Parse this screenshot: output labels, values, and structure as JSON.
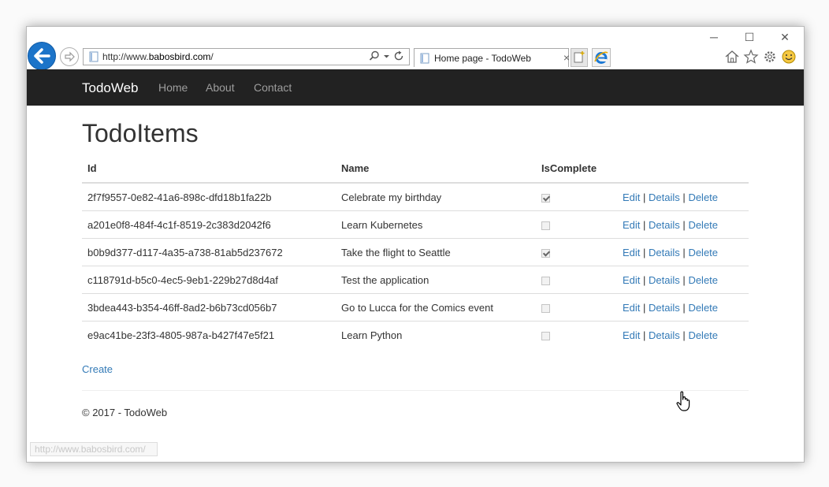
{
  "browser": {
    "url_prefix": "http://www.",
    "url_host": "babosbird.com",
    "url_suffix": "/",
    "tab_title": "Home page - TodoWeb",
    "tab_close": "×",
    "status_url": "http://www.babosbird.com/"
  },
  "nav": {
    "brand": "TodoWeb",
    "links": [
      "Home",
      "About",
      "Contact"
    ]
  },
  "page": {
    "title": "TodoItems",
    "columns": [
      "Id",
      "Name",
      "IsComplete"
    ],
    "rows": [
      {
        "id": "2f7f9557-0e82-41a6-898c-dfd18b1fa22b",
        "name": "Celebrate my birthday",
        "complete": true
      },
      {
        "id": "a201e0f8-484f-4c1f-8519-2c383d2042f6",
        "name": "Learn Kubernetes",
        "complete": false
      },
      {
        "id": "b0b9d377-d117-4a35-a738-81ab5d237672",
        "name": "Take the flight to Seattle",
        "complete": true
      },
      {
        "id": "c118791d-b5c0-4ec5-9eb1-229b27d8d4af",
        "name": "Test the application",
        "complete": false
      },
      {
        "id": "3bdea443-b354-46ff-8ad2-b6b73cd056b7",
        "name": "Go to Lucca for the Comics event",
        "complete": false
      },
      {
        "id": "e9ac41be-23f3-4805-987a-b427f47e5f21",
        "name": "Learn Python",
        "complete": false
      }
    ],
    "actions": {
      "edit": "Edit",
      "details": "Details",
      "delete": "Delete",
      "separator": "|"
    },
    "create_label": "Create",
    "footer": "© 2017 - TodoWeb"
  },
  "colors": {
    "navbar": "#222222",
    "link": "#337ab7",
    "back_button": "#1c74c9"
  },
  "icons": {
    "back": "back-arrow-icon",
    "forward": "forward-arrow-icon",
    "search": "search-icon",
    "refresh": "refresh-icon",
    "home": "home-icon",
    "favorites": "star-icon",
    "settings": "gear-icon",
    "feedback": "smiley-icon"
  }
}
